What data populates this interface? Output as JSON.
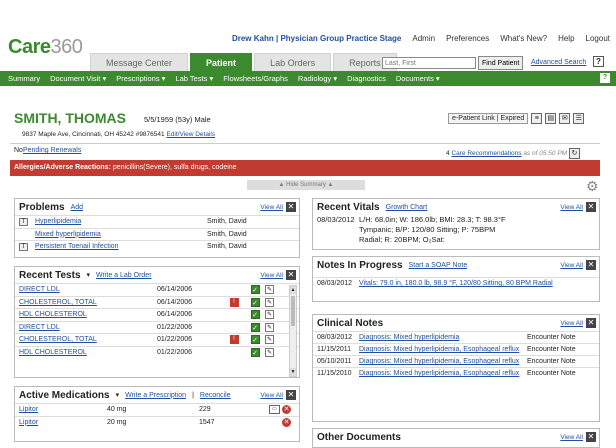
{
  "brand": {
    "name": "Care",
    "suffix": "360"
  },
  "topbar": {
    "user": "Drew Kahn | Physician Group Practice Stage",
    "admin": "Admin",
    "preferences": "Preferences",
    "whats_new": "What's New?",
    "help": "Help",
    "logout": "Logout"
  },
  "tabs": [
    "Message Center",
    "Patient",
    "Lab Orders",
    "Reports"
  ],
  "search": {
    "placeholder": "Last, First",
    "find": "Find Patient",
    "advanced": "Advanced Search"
  },
  "nav": [
    "Summary",
    "Document Visit ▾",
    "Prescriptions ▾",
    "Lab Tests ▾",
    "Flowsheets/Graphs",
    "Radiology ▾",
    "Diagnostics",
    "Documents ▾"
  ],
  "patient": {
    "name": "SMITH, THOMAS",
    "demo": "5/5/1959 (53y) Male",
    "address": "9837 Maple Ave, Cincinnati, OH 45242 #9876541",
    "edit_link": "Edit/View Details",
    "elink": "e-Patient Link",
    "expired": "Expired"
  },
  "renewals": {
    "prefix": "No",
    "link": "Pending Renewals"
  },
  "care_recs": {
    "count": "4",
    "link": "Care Recommendations",
    "asof": "as of 05:50 PM"
  },
  "allergies": {
    "label": "Allergies/Adverse Reactions:",
    "value": "penicillins(Severe), sulfa drugs, codeine"
  },
  "hide_summary": "Hide Summary",
  "problems": {
    "title": "Problems",
    "add": "Add",
    "view_all": "View All",
    "items": [
      {
        "name": "Hyperlipidemia",
        "doctor": "Smith, David"
      },
      {
        "name": "Mixed hyperlipidemia",
        "doctor": "Smith, David"
      },
      {
        "name": "Persistent Toenail Infection",
        "doctor": "Smith, David"
      }
    ]
  },
  "tests": {
    "title": "Recent Tests",
    "order": "Write a Lab Order",
    "view_all": "View All",
    "items": [
      {
        "name": "DIRECT LDL",
        "date": "06/14/2006",
        "alert": false
      },
      {
        "name": "CHOLESTEROL, TOTAL",
        "date": "06/14/2006",
        "alert": true
      },
      {
        "name": "HDL CHOLESTEROL",
        "date": "06/14/2006",
        "alert": false
      },
      {
        "name": "DIRECT LDL",
        "date": "01/22/2006",
        "alert": false
      },
      {
        "name": "CHOLESTEROL, TOTAL",
        "date": "01/22/2006",
        "alert": true
      },
      {
        "name": "HDL CHOLESTEROL",
        "date": "01/22/2006",
        "alert": false
      }
    ]
  },
  "meds": {
    "title": "Active Medications",
    "write": "Write a Prescription",
    "reconcile": "Reconcile",
    "view_all": "View All",
    "items": [
      {
        "name": "Lipitor",
        "dose": "40 mg",
        "count": "229"
      },
      {
        "name": "Lipitor",
        "dose": "20 mg",
        "count": "1547"
      }
    ]
  },
  "vitals": {
    "title": "Recent Vitals",
    "growth": "Growth Chart",
    "view_all": "View All",
    "date": "08/03/2012",
    "line1": "L/H: 68.0in; W: 186.0lb; BMI: 28.3; T: 98.3°F",
    "line2": "Tympanic; B/P: 120/80 Sitting; P: 75BPM",
    "line3": "Radial; R: 20BPM; O₂Sat:"
  },
  "progress": {
    "title": "Notes In Progress",
    "soap": "Start a SOAP Note",
    "view_all": "View All",
    "date": "08/03/2012",
    "text": "Vitals: 79.0 in, 180.0 lb, 98.9 °F, 120/80 Sitting, 80 BPM Radial"
  },
  "clinical": {
    "title": "Clinical Notes",
    "view_all": "View All",
    "items": [
      {
        "date": "08/03/2012",
        "text": "Diagnosis: Mixed hyperlipidemia",
        "type": "Encounter Note"
      },
      {
        "date": "11/15/2011",
        "text": "Diagnosis: Mixed hyperlipidemia, Esophageal reflux",
        "type": "Encounter Note"
      },
      {
        "date": "05/10/2011",
        "text": "Diagnosis: Mixed hyperlipidemia, Esophageal reflux",
        "type": "Encounter Note"
      },
      {
        "date": "11/15/2010",
        "text": "Diagnosis: Mixed hyperlipidemia, Esophageal reflux",
        "type": "Encounter Note"
      }
    ]
  },
  "other_docs": {
    "title": "Other Documents",
    "view_all": "View All"
  }
}
